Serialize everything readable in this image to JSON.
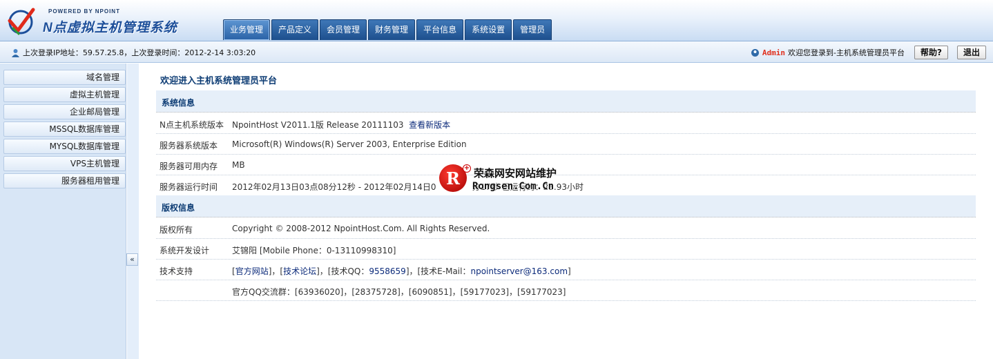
{
  "header": {
    "powered_by": "POWERED BY NPOINT",
    "app_title": "N点虚拟主机管理系统",
    "tabs": [
      {
        "label": "业务管理",
        "active": true
      },
      {
        "label": "产品定义"
      },
      {
        "label": "会员管理"
      },
      {
        "label": "财务管理"
      },
      {
        "label": "平台信息"
      },
      {
        "label": "系统设置"
      },
      {
        "label": "管理员"
      }
    ]
  },
  "infobar": {
    "last_login": "上次登录IP地址：59.57.25.8，上次登录时间：2012-2-14 3:03:20",
    "user": "Admin",
    "welcome": "欢迎您登录到-主机系统管理员平台",
    "help_label": "帮助?",
    "logout_label": "退出"
  },
  "sidebar": {
    "items": [
      {
        "label": "域名管理"
      },
      {
        "label": "虚拟主机管理"
      },
      {
        "label": "企业邮局管理"
      },
      {
        "label": "MSSQL数据库管理"
      },
      {
        "label": "MYSQL数据库管理"
      },
      {
        "label": "VPS主机管理"
      },
      {
        "label": "服务器租用管理"
      }
    ],
    "collapse_label": "«"
  },
  "main": {
    "title": "欢迎进入主机系统管理员平台",
    "section_system": "系统信息",
    "section_copyright": "版权信息",
    "system_rows": {
      "version_key": "N点主机系统版本",
      "version_val": "NpointHost V2011.1版 Release 20111103",
      "version_link": "查看新版本",
      "os_key": "服务器系统版本",
      "os_val": "Microsoft(R) Windows(R) Server 2003, Enterprise Edition",
      "mem_key": "服务器可用内存",
      "mem_val": "MB",
      "uptime_key": "服务器运行时间",
      "uptime_val": "2012年02月13日03点08分12秒 - 2012年02月14日0",
      "uptime_tail": "分17秒 已运行约：23.93小时"
    },
    "copyright_rows": {
      "owner_key": "版权所有",
      "owner_val": "Copyright © 2008-2012 NpointHost.Com. All Rights Reserved.",
      "dev_key": "系统开发设计",
      "dev_val": "艾锦阳 [Mobile Phone：0-13110998310]",
      "support_key": "技术支持",
      "support_prefix": "[",
      "official_site": "官方网站",
      "sep1": "]，[",
      "forum": "技术论坛",
      "qq_prefix": "]，[技术QQ：",
      "qq": "9558659",
      "email_prefix": "]，[技术E-Mail：",
      "email": "npointserver@163.com",
      "email_suffix": "]",
      "qq_groups": "官方QQ交流群：[63936020]，[28375728]，[6090851]，[59177023]，[59177023]"
    }
  },
  "watermark": {
    "letter": "R",
    "plus": "+",
    "cn": "荣森网安网站维护",
    "en": "Rongsen.Com.Cn"
  }
}
